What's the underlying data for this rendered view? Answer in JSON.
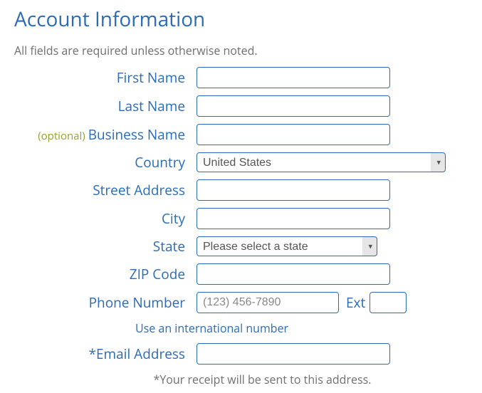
{
  "heading": "Account Information",
  "subhead": "All fields are required unless otherwise noted.",
  "optional_tag": "(optional)",
  "labels": {
    "first_name": "First Name",
    "last_name": "Last Name",
    "business": "Business Name",
    "country": "Country",
    "street": "Street Address",
    "city": "City",
    "state": "State",
    "zip": "ZIP Code",
    "phone": "Phone Number",
    "ext": "Ext",
    "email": "*Email Address"
  },
  "values": {
    "country_selected": "United States",
    "state_selected": "Please select a state",
    "phone_placeholder": "(123) 456-7890"
  },
  "intl_link": "Use an international number",
  "receipt_note": "*Your receipt will be sent to this address."
}
